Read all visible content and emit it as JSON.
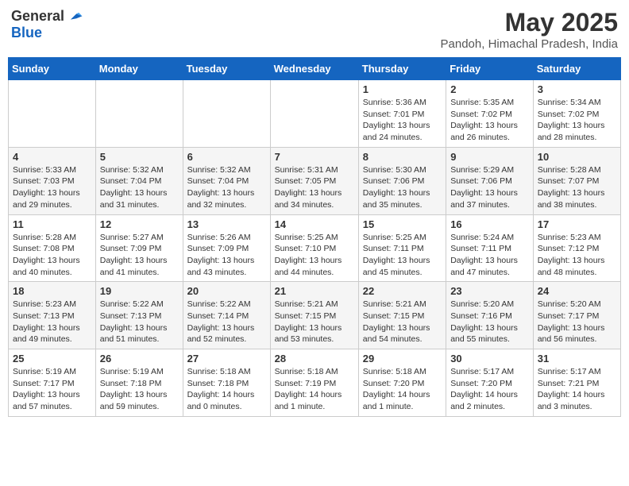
{
  "header": {
    "logo_general": "General",
    "logo_blue": "Blue",
    "month_title": "May 2025",
    "location": "Pandoh, Himachal Pradesh, India"
  },
  "weekdays": [
    "Sunday",
    "Monday",
    "Tuesday",
    "Wednesday",
    "Thursday",
    "Friday",
    "Saturday"
  ],
  "weeks": [
    [
      {
        "day": "",
        "info": ""
      },
      {
        "day": "",
        "info": ""
      },
      {
        "day": "",
        "info": ""
      },
      {
        "day": "",
        "info": ""
      },
      {
        "day": "1",
        "info": "Sunrise: 5:36 AM\nSunset: 7:01 PM\nDaylight: 13 hours\nand 24 minutes."
      },
      {
        "day": "2",
        "info": "Sunrise: 5:35 AM\nSunset: 7:02 PM\nDaylight: 13 hours\nand 26 minutes."
      },
      {
        "day": "3",
        "info": "Sunrise: 5:34 AM\nSunset: 7:02 PM\nDaylight: 13 hours\nand 28 minutes."
      }
    ],
    [
      {
        "day": "4",
        "info": "Sunrise: 5:33 AM\nSunset: 7:03 PM\nDaylight: 13 hours\nand 29 minutes."
      },
      {
        "day": "5",
        "info": "Sunrise: 5:32 AM\nSunset: 7:04 PM\nDaylight: 13 hours\nand 31 minutes."
      },
      {
        "day": "6",
        "info": "Sunrise: 5:32 AM\nSunset: 7:04 PM\nDaylight: 13 hours\nand 32 minutes."
      },
      {
        "day": "7",
        "info": "Sunrise: 5:31 AM\nSunset: 7:05 PM\nDaylight: 13 hours\nand 34 minutes."
      },
      {
        "day": "8",
        "info": "Sunrise: 5:30 AM\nSunset: 7:06 PM\nDaylight: 13 hours\nand 35 minutes."
      },
      {
        "day": "9",
        "info": "Sunrise: 5:29 AM\nSunset: 7:06 PM\nDaylight: 13 hours\nand 37 minutes."
      },
      {
        "day": "10",
        "info": "Sunrise: 5:28 AM\nSunset: 7:07 PM\nDaylight: 13 hours\nand 38 minutes."
      }
    ],
    [
      {
        "day": "11",
        "info": "Sunrise: 5:28 AM\nSunset: 7:08 PM\nDaylight: 13 hours\nand 40 minutes."
      },
      {
        "day": "12",
        "info": "Sunrise: 5:27 AM\nSunset: 7:09 PM\nDaylight: 13 hours\nand 41 minutes."
      },
      {
        "day": "13",
        "info": "Sunrise: 5:26 AM\nSunset: 7:09 PM\nDaylight: 13 hours\nand 43 minutes."
      },
      {
        "day": "14",
        "info": "Sunrise: 5:25 AM\nSunset: 7:10 PM\nDaylight: 13 hours\nand 44 minutes."
      },
      {
        "day": "15",
        "info": "Sunrise: 5:25 AM\nSunset: 7:11 PM\nDaylight: 13 hours\nand 45 minutes."
      },
      {
        "day": "16",
        "info": "Sunrise: 5:24 AM\nSunset: 7:11 PM\nDaylight: 13 hours\nand 47 minutes."
      },
      {
        "day": "17",
        "info": "Sunrise: 5:23 AM\nSunset: 7:12 PM\nDaylight: 13 hours\nand 48 minutes."
      }
    ],
    [
      {
        "day": "18",
        "info": "Sunrise: 5:23 AM\nSunset: 7:13 PM\nDaylight: 13 hours\nand 49 minutes."
      },
      {
        "day": "19",
        "info": "Sunrise: 5:22 AM\nSunset: 7:13 PM\nDaylight: 13 hours\nand 51 minutes."
      },
      {
        "day": "20",
        "info": "Sunrise: 5:22 AM\nSunset: 7:14 PM\nDaylight: 13 hours\nand 52 minutes."
      },
      {
        "day": "21",
        "info": "Sunrise: 5:21 AM\nSunset: 7:15 PM\nDaylight: 13 hours\nand 53 minutes."
      },
      {
        "day": "22",
        "info": "Sunrise: 5:21 AM\nSunset: 7:15 PM\nDaylight: 13 hours\nand 54 minutes."
      },
      {
        "day": "23",
        "info": "Sunrise: 5:20 AM\nSunset: 7:16 PM\nDaylight: 13 hours\nand 55 minutes."
      },
      {
        "day": "24",
        "info": "Sunrise: 5:20 AM\nSunset: 7:17 PM\nDaylight: 13 hours\nand 56 minutes."
      }
    ],
    [
      {
        "day": "25",
        "info": "Sunrise: 5:19 AM\nSunset: 7:17 PM\nDaylight: 13 hours\nand 57 minutes."
      },
      {
        "day": "26",
        "info": "Sunrise: 5:19 AM\nSunset: 7:18 PM\nDaylight: 13 hours\nand 59 minutes."
      },
      {
        "day": "27",
        "info": "Sunrise: 5:18 AM\nSunset: 7:18 PM\nDaylight: 14 hours\nand 0 minutes."
      },
      {
        "day": "28",
        "info": "Sunrise: 5:18 AM\nSunset: 7:19 PM\nDaylight: 14 hours\nand 1 minute."
      },
      {
        "day": "29",
        "info": "Sunrise: 5:18 AM\nSunset: 7:20 PM\nDaylight: 14 hours\nand 1 minute."
      },
      {
        "day": "30",
        "info": "Sunrise: 5:17 AM\nSunset: 7:20 PM\nDaylight: 14 hours\nand 2 minutes."
      },
      {
        "day": "31",
        "info": "Sunrise: 5:17 AM\nSunset: 7:21 PM\nDaylight: 14 hours\nand 3 minutes."
      }
    ]
  ]
}
